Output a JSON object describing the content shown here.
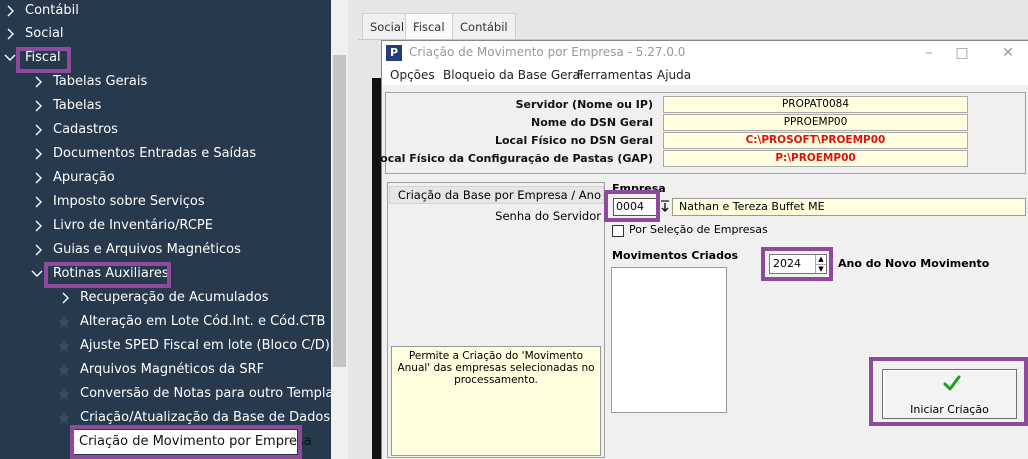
{
  "nav": {
    "items": [
      {
        "label": "Contábil"
      },
      {
        "label": "Social"
      },
      {
        "label": "Fiscal"
      },
      {
        "label": "Tabelas Gerais"
      },
      {
        "label": "Tabelas"
      },
      {
        "label": "Cadastros"
      },
      {
        "label": "Documentos Entradas e Saídas"
      },
      {
        "label": "Apuração"
      },
      {
        "label": "Imposto sobre Serviços"
      },
      {
        "label": "Livro de Inventário/RCPE"
      },
      {
        "label": "Guias e Arquivos Magnéticos"
      },
      {
        "label": "Rotinas Auxiliares"
      },
      {
        "label": "Recuperação de Acumulados"
      },
      {
        "label": "Alteração em Lote Cód.Int. e Cód.CTB"
      },
      {
        "label": "Ajuste SPED Fiscal em lote (Bloco C/D)"
      },
      {
        "label": "Arquivos Magnéticos da SRF"
      },
      {
        "label": "Conversão de Notas para outro Template"
      },
      {
        "label": "Criação/Atualização da Base de Dados"
      },
      {
        "label": "Criação de Movimento por Empresa"
      }
    ]
  },
  "tabs": [
    {
      "label": "Social"
    },
    {
      "label": "Fiscal"
    },
    {
      "label": "Contábil"
    }
  ],
  "dialog": {
    "app_icon": "P",
    "title": "Criação de Movimento por Empresa - 5.27.0.0",
    "menu": [
      "Opções",
      "Bloqueio da Base Geral",
      "Ferramentas",
      "Ajuda"
    ],
    "info": [
      {
        "label": "Servidor (Nome ou IP)",
        "value": "PROPAT0084"
      },
      {
        "label": "Nome do DSN Geral",
        "value": "PPROEMP00"
      },
      {
        "label": "Local Físico no DSN Geral",
        "value": "C:\\PROSOFT\\PROEMP00"
      },
      {
        "label": "Local Físico da Configuração de Pastas (GAP)",
        "value": "P:\\PROEMP00"
      }
    ],
    "left_options": [
      "Criação da Base por Empresa / Ano",
      "Senha do Servidor"
    ],
    "hint": "Permite a Criação do 'Movimento Anual' das empresas selecionadas no processamento.",
    "empresa": {
      "label": "Empresa",
      "code": "0004",
      "name": "Nathan e Tereza Buffet ME",
      "checkbox_label": "Por Seleção de Empresas",
      "checkbox_checked": false
    },
    "movimentos_label": "Movimentos Criados",
    "year": {
      "value": "2024",
      "label": "Ano do Novo Movimento"
    },
    "iniciar_label": "Iniciar Criação"
  },
  "colors": {
    "nav_bg": "#27394d",
    "highlight": "#8e4a9b",
    "field_yellow": "#ffffe0",
    "path_red": "#e01010",
    "check_green": "#1ea01e"
  }
}
